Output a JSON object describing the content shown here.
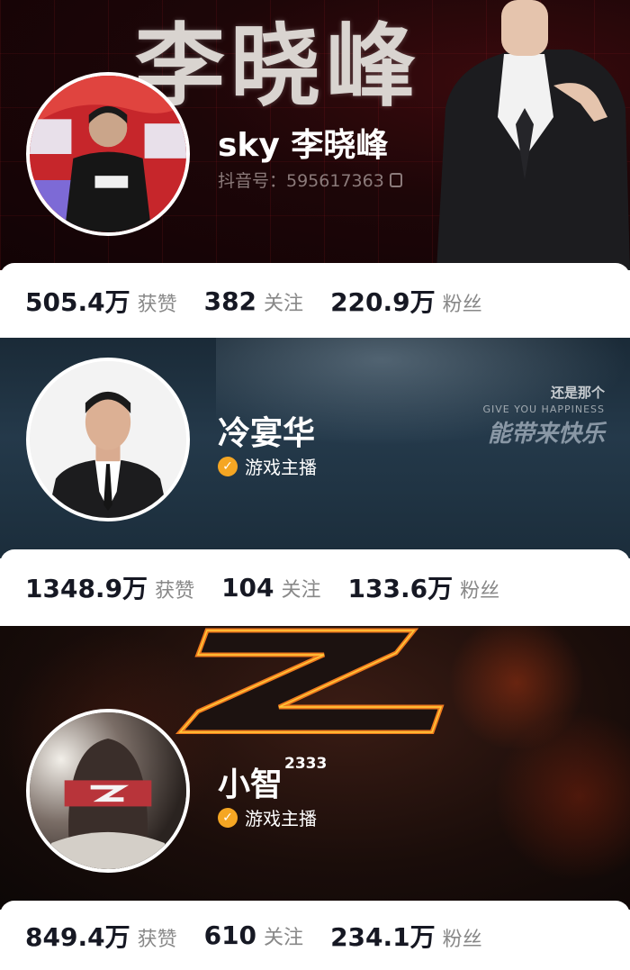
{
  "profiles": [
    {
      "banner_title": "李晓峰",
      "name": "sky 李晓峰",
      "douyin_id": "抖音号：595617363",
      "stats": [
        {
          "value": "505.4万",
          "label": "获赞"
        },
        {
          "value": "382",
          "label": "关注"
        },
        {
          "value": "220.9万",
          "label": "粉丝"
        }
      ]
    },
    {
      "name": "冷宴华",
      "badge": "游戏主播",
      "slogan": {
        "line1": "还是那个",
        "line2": "GIVE YOU HAPPINESS",
        "line3": "能带来快乐"
      },
      "stats": [
        {
          "value": "1348.9万",
          "label": "获赞"
        },
        {
          "value": "104",
          "label": "关注"
        },
        {
          "value": "133.6万",
          "label": "粉丝"
        }
      ]
    },
    {
      "name": "小智",
      "name_suffix": "2333",
      "badge": "游戏主播",
      "stats": [
        {
          "value": "849.4万",
          "label": "获赞"
        },
        {
          "value": "610",
          "label": "关注"
        },
        {
          "value": "234.1万",
          "label": "粉丝"
        }
      ]
    }
  ],
  "colors": {
    "badge_check": "#f5a623",
    "stat_number": "#161823",
    "stat_label": "#888888"
  }
}
